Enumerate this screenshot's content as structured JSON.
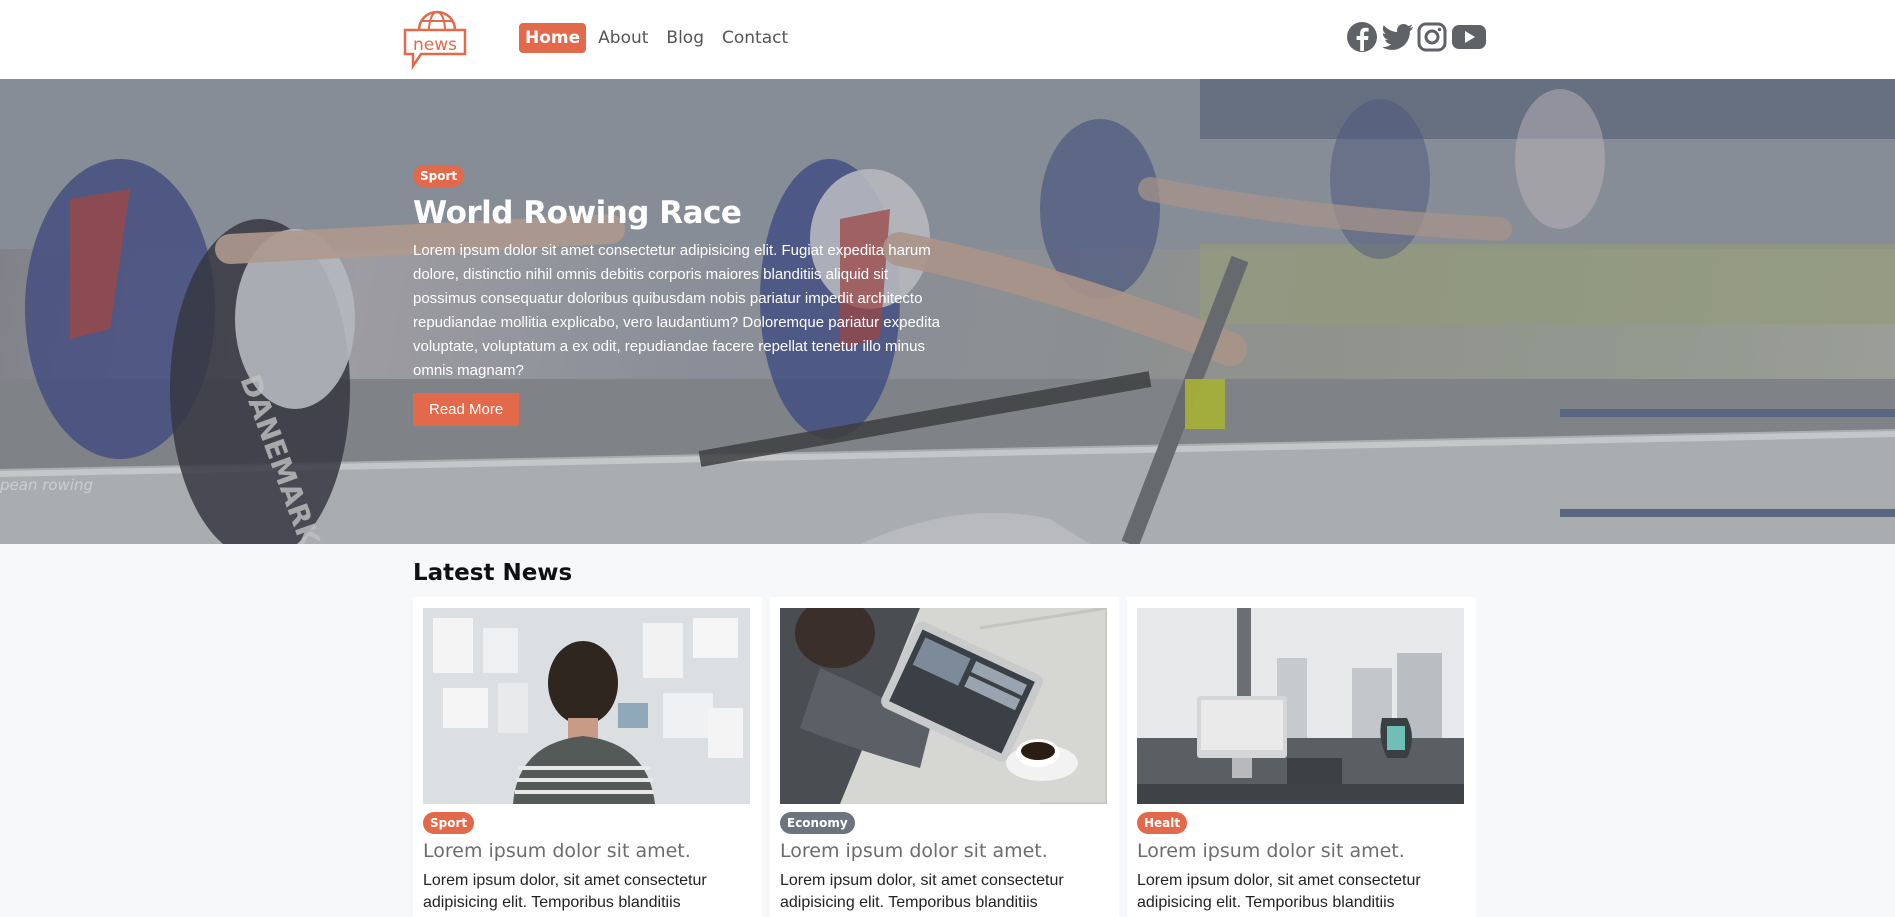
{
  "header": {
    "logo_text": "news",
    "nav": [
      {
        "label": "Home",
        "active": true
      },
      {
        "label": "About",
        "active": false
      },
      {
        "label": "Blog",
        "active": false
      },
      {
        "label": "Contact",
        "active": false
      }
    ],
    "social_icons": [
      "facebook-icon",
      "twitter-icon",
      "instagram-icon",
      "youtube-icon"
    ]
  },
  "hero": {
    "category": "Sport",
    "title": "World Rowing Race",
    "text": "Lorem ipsum dolor sit amet consectetur adipisicing elit. Fugiat expedita harum dolore, distinctio nihil omnis debitis corporis maiores blanditiis aliquid sit possimus consequatur doloribus quibusdam nobis pariatur impedit architecto repudiandae mollitia explicabo, vero laudantium? Doloremque pariatur expedita voluptate, voluptatum a ex odit, repudiandae facere repellat tenetur illo minus omnis magnam?",
    "button": "Read More",
    "scene_text": [
      "pean rowing",
      "DANEMARK"
    ]
  },
  "latest": {
    "heading": "Latest News",
    "cards": [
      {
        "category": "Sport",
        "badge_color": "#e2694a",
        "title": "Lorem ipsum dolor sit amet.",
        "text": "Lorem ipsum dolor, sit amet consectetur adipisicing elit. Temporibus blanditiis"
      },
      {
        "category": "Economy",
        "badge_color": "#6c757d",
        "title": "Lorem ipsum dolor sit amet.",
        "text": "Lorem ipsum dolor, sit amet consectetur adipisicing elit. Temporibus blanditiis"
      },
      {
        "category": "Healt",
        "badge_color": "#e2694a",
        "title": "Lorem ipsum dolor sit amet.",
        "text": "Lorem ipsum dolor, sit amet consectetur adipisicing elit. Temporibus blanditiis"
      }
    ]
  },
  "colors": {
    "accent": "#e2694a",
    "muted": "#6c757d"
  }
}
